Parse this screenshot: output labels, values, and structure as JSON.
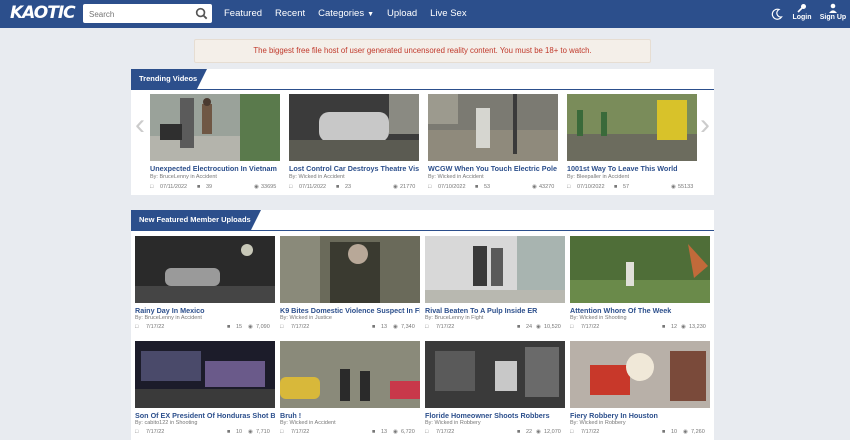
{
  "header": {
    "logo_text": "KAOTIC",
    "search_placeholder": "Search",
    "nav": [
      "Featured",
      "Recent",
      "Categories",
      "Upload",
      "Live Sex"
    ],
    "login_label": "Login",
    "signup_label": "Sign Up"
  },
  "notice": "The biggest free file host of user generated uncensored reality content. You must be 18+ to watch.",
  "trending": {
    "heading": "Trending Videos",
    "videos": [
      {
        "title": "Unexpected Electrocution In Vietnam",
        "by": "By: BruceLenny in Accident",
        "date": "07/11/2022",
        "comments": "39",
        "views": "33695"
      },
      {
        "title": "Lost Control Car Destroys Theatre Visi...",
        "by": "By: Wicked in Accident",
        "date": "07/11/2022",
        "comments": "23",
        "views": "21770"
      },
      {
        "title": "WCGW When You Touch Electric Pole ...",
        "by": "By: Wicked in Accident",
        "date": "07/10/2022",
        "comments": "53",
        "views": "43270"
      },
      {
        "title": "1001st Way To Leave This World",
        "by": "By: Bleepaller in Accident",
        "date": "07/10/2022",
        "comments": "57",
        "views": "55133"
      }
    ]
  },
  "featured": {
    "heading": "New Featured Member Uploads",
    "videos": [
      {
        "title": "Rainy Day In Mexico",
        "by": "By: BruceLenny in Accident",
        "date": "7/17/22",
        "comments": "15",
        "views": "7,090"
      },
      {
        "title": "K9 Bites Domestic Violence Suspect In Fl...",
        "by": "By: Wicked in Justice",
        "date": "7/17/22",
        "comments": "13",
        "views": "7,340"
      },
      {
        "title": "Rival Beaten To A Pulp Inside ER",
        "by": "By: BruceLenny in Fight",
        "date": "7/17/22",
        "comments": "24",
        "views": "10,520"
      },
      {
        "title": "Attention Whore Of The Week",
        "by": "By: Wicked in Shooting",
        "date": "7/17/22",
        "comments": "12",
        "views": "13,230"
      },
      {
        "title": "Son Of EX President Of Honduras Shot By ...",
        "by": "By: cabito122 in Shooting",
        "date": "7/17/22",
        "comments": "10",
        "views": "7,710"
      },
      {
        "title": "Bruh !",
        "by": "By: Wicked in Accident",
        "date": "7/17/22",
        "comments": "13",
        "views": "6,720"
      },
      {
        "title": "Floride Homeowner Shoots Robbers",
        "by": "By: Wicked in Robbery",
        "date": "7/17/22",
        "comments": "22",
        "views": "12,070"
      },
      {
        "title": "Fiery Robbery In Houston",
        "by": "By: Wicked in Robbery",
        "date": "7/17/22",
        "comments": "10",
        "views": "7,260"
      }
    ]
  },
  "colors": {
    "brand": "#2c4f8c",
    "notice_text": "#c0392b",
    "background": "#e8ebf0"
  },
  "icons": [
    "search-icon",
    "moon-icon",
    "key-icon",
    "user-icon",
    "calendar-icon",
    "comment-icon",
    "eye-icon",
    "chevron-left-icon",
    "chevron-right-icon"
  ]
}
